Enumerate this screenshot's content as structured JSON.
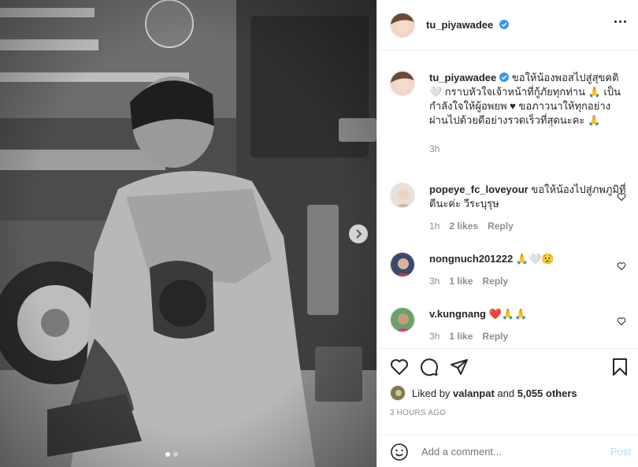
{
  "post": {
    "author": "tu_piyawadee",
    "caption": "ขอให้น้องพอสไปสู่สุขคติ 🤍 กราบหัวใจเจ้าหน้าที่กู้ภัยทุกท่าน 🙏 เป็นกำลังใจให้ผู้อพยพ ♥ ขอภาวนาให้ทุกอย่างผ่านไปด้วยดีอย่างรวดเร็วที่สุดนะคะ 🙏",
    "caption_time": "3h"
  },
  "comments": [
    {
      "user": "popeye_fc_loveyour",
      "text": "ขอให้น้องไปสู่ภพภูมิที่ดีนะค่ะ วีระบุรุษ",
      "time": "1h",
      "likes": "2 likes",
      "reply": "Reply"
    },
    {
      "user": "nongnuch201222",
      "text": "🙏🤍😟",
      "time": "3h",
      "likes": "1 like",
      "reply": "Reply"
    },
    {
      "user": "v.kungnang",
      "text": "❤️🙏🙏",
      "time": "3h",
      "likes": "1 like",
      "reply": "Reply"
    }
  ],
  "likes": {
    "prefix": "Liked by",
    "user": "valanpat",
    "conj": "and",
    "others": "5,055 others"
  },
  "timestamp": "3 HOURS AGO",
  "add_comment": {
    "placeholder": "Add a comment...",
    "post_label": "Post"
  },
  "colors": {
    "verified": "#3897f0",
    "post_disabled": "#b2dffc",
    "secondary": "#8e8e8e"
  },
  "icons": [
    "heart-icon",
    "comment-icon",
    "share-icon",
    "bookmark-icon",
    "emoji-icon",
    "more-icon",
    "chevron-right-icon",
    "verified-badge-icon"
  ]
}
